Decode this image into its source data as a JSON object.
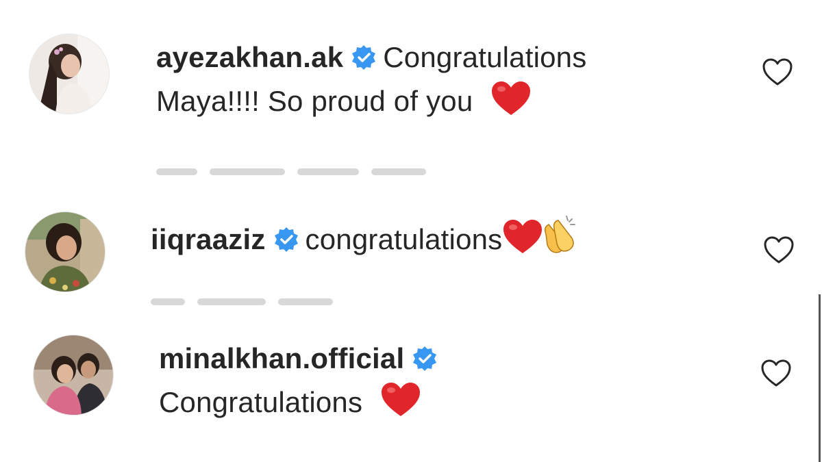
{
  "comments": [
    {
      "username": "ayezakhan.ak",
      "text_line1": "Congratulations",
      "text_line2": "Maya!!!! So proud of you",
      "emoji": [
        "heart-emoji"
      ],
      "verified": true
    },
    {
      "username": "iiqraaziz",
      "text_line1": "congratulations",
      "emoji": [
        "heart-emoji",
        "clapping-hands-emoji"
      ],
      "verified": true
    },
    {
      "username": "minalkhan.official",
      "text_line1": "Congratulations",
      "emoji": [
        "heart-emoji"
      ],
      "verified": true
    }
  ],
  "colors": {
    "verified_badge": "#3897f0",
    "heart_emoji": "#e0252b",
    "text": "#262626",
    "icon_stroke": "#262626"
  },
  "icons": {
    "like": "heart-outline-icon",
    "verified": "verified-badge-icon"
  }
}
